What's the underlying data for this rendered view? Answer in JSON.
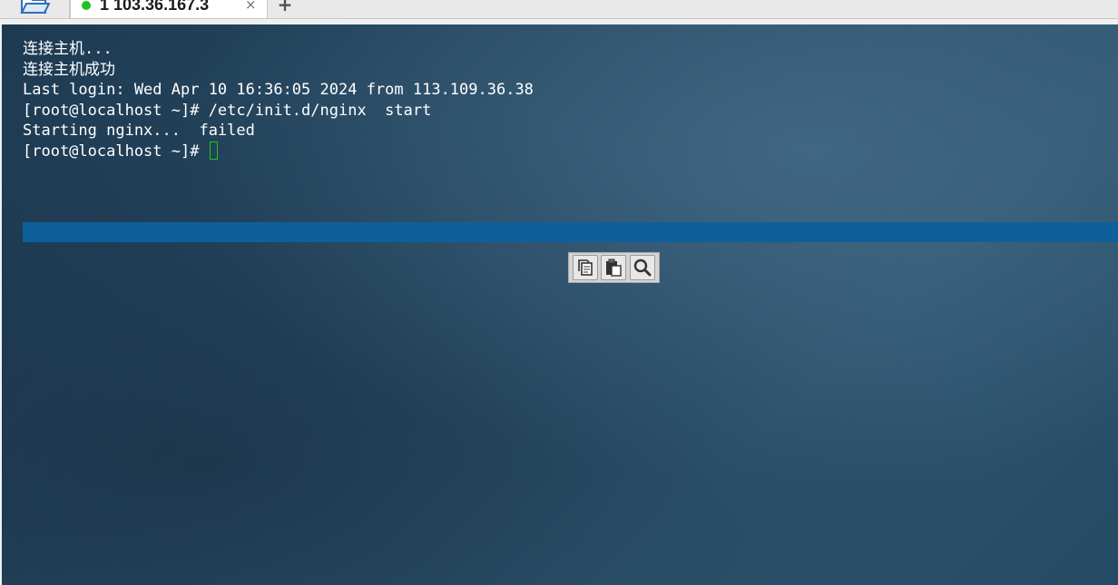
{
  "tabbar": {
    "folder_icon": "folder-open-icon",
    "tabs": [
      {
        "label": "1 103.36.167.3",
        "status_color": "#1ec41e",
        "close_glyph": "×"
      }
    ],
    "add_glyph": "+"
  },
  "terminal": {
    "lines": [
      "连接主机...",
      "连接主机成功",
      "Last login: Wed Apr 10 16:36:05 2024 from 113.109.36.38",
      "[root@localhost ~]# /etc/init.d/nginx  start",
      "Starting nginx...  failed",
      "[root@localhost ~]# "
    ],
    "cursor_color": "#1ec41e",
    "selection_color": "#0f5f9b"
  },
  "mini_toolbar": {
    "buttons": [
      "copy-icon",
      "paste-icon",
      "search-icon"
    ]
  }
}
